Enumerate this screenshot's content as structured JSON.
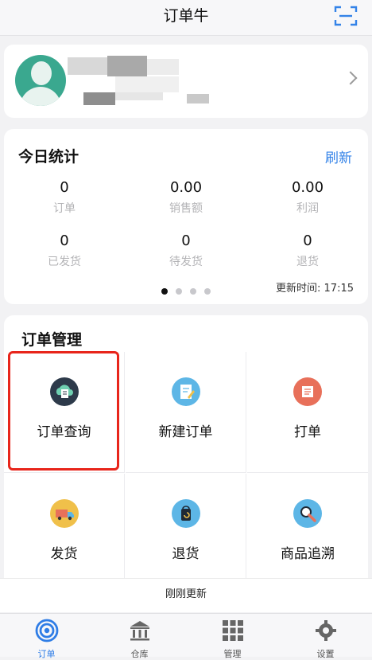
{
  "header": {
    "title": "订单牛",
    "scan_icon": "scan-icon"
  },
  "profile": {
    "avatar_icon": "user-avatar-icon",
    "chevron_icon": "chevron-right-icon"
  },
  "stats": {
    "title": "今日统计",
    "refresh_label": "刷新",
    "items": [
      {
        "value": "0",
        "label": "订单"
      },
      {
        "value": "0.00",
        "label": "销售额"
      },
      {
        "value": "0.00",
        "label": "利润"
      },
      {
        "value": "0",
        "label": "已发货"
      },
      {
        "value": "0",
        "label": "待发货"
      },
      {
        "value": "0",
        "label": "退货"
      }
    ],
    "page_count": 4,
    "active_page": 1,
    "update_time": "更新时间: 17:15"
  },
  "order_mgmt": {
    "title": "订单管理",
    "items": [
      {
        "label": "订单查询",
        "icon": "order-query-icon",
        "color": "#2d3a4a"
      },
      {
        "label": "新建订单",
        "icon": "new-order-icon",
        "color": "#5db6e6"
      },
      {
        "label": "打单",
        "icon": "print-icon",
        "color": "#e8705a"
      },
      {
        "label": "发货",
        "icon": "delivery-truck-icon",
        "color": "#f0c04a"
      },
      {
        "label": "退货",
        "icon": "return-bag-icon",
        "color": "#5db6e6"
      },
      {
        "label": "商品追溯",
        "icon": "magnifier-icon",
        "color": "#5db6e6"
      }
    ]
  },
  "updated_text": "刚刚更新",
  "tabs": [
    {
      "label": "订单",
      "icon": "target-icon",
      "active": true
    },
    {
      "label": "仓库",
      "icon": "warehouse-icon",
      "active": false
    },
    {
      "label": "管理",
      "icon": "grid-icon",
      "active": false
    },
    {
      "label": "设置",
      "icon": "gear-icon",
      "active": false
    }
  ],
  "colors": {
    "accent": "#3483e8",
    "highlight": "#e8251b"
  }
}
